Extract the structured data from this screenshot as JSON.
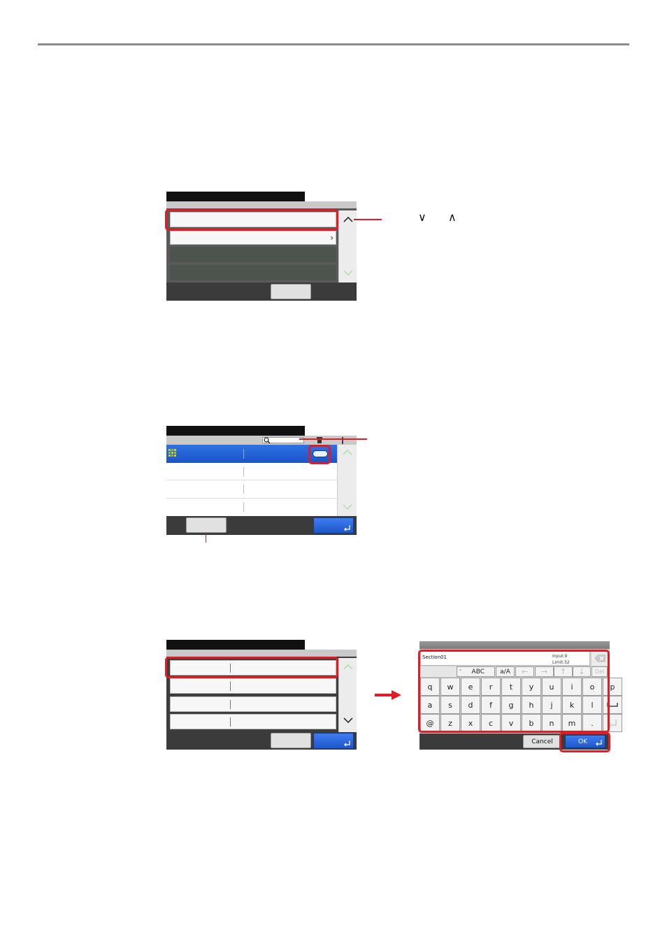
{
  "icons": [
    "chevron-up-icon",
    "chevron-down-icon",
    "chevron-right-icon",
    "search-icon",
    "trash-icon",
    "plus-icon",
    "enter-icon",
    "grid-icon",
    "backspace-icon",
    "space-icon",
    "arrow-left-icon",
    "arrow-right-icon",
    "arrow-up-icon",
    "arrow-down-icon"
  ],
  "annotation1": {
    "chev_down": "∨",
    "chev_up": "∧"
  },
  "keyboard": {
    "input_value": "Section01",
    "input_label": "Input:9",
    "limit_label": "Limit:32",
    "abc_label": "ABC",
    "case_label": "a/A",
    "del_label": "Del",
    "row1": [
      "q",
      "w",
      "e",
      "r",
      "t",
      "y",
      "u",
      "i",
      "o",
      "p"
    ],
    "row2": [
      "a",
      "s",
      "d",
      "f",
      "g",
      "h",
      "j",
      "k",
      "l"
    ],
    "row3": [
      "@",
      "z",
      "x",
      "c",
      "v",
      "b",
      "n",
      "m",
      "."
    ],
    "cancel_label": "Cancel",
    "ok_label": "OK"
  },
  "colors": {
    "accent_red": "#e21c24",
    "select_blue": "#1d57c9"
  }
}
